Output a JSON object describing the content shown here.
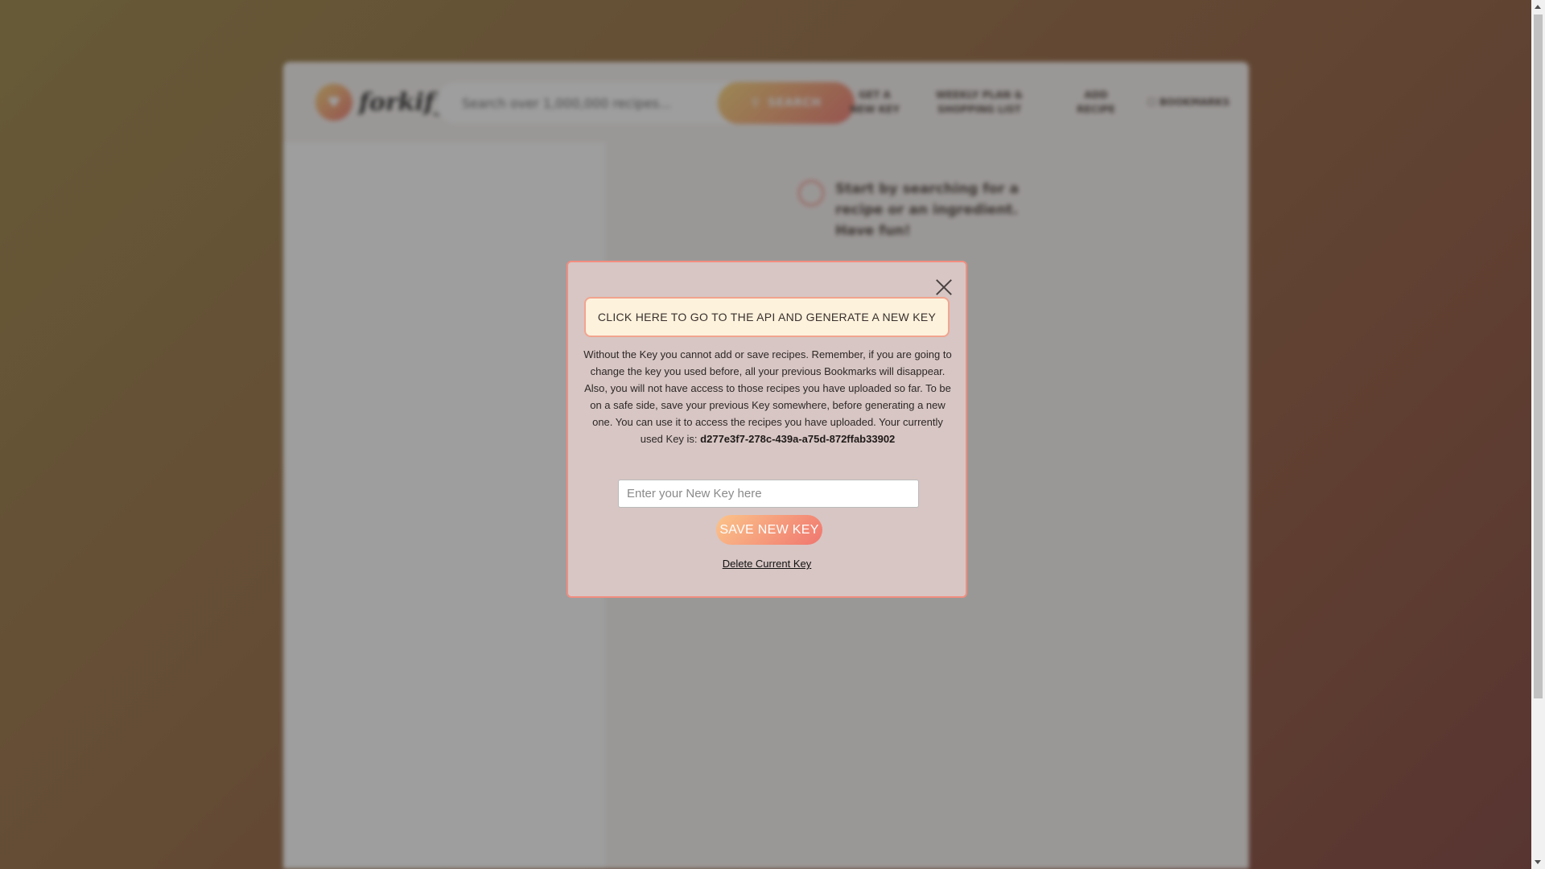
{
  "header": {
    "logo_text": "forkify",
    "search_placeholder": "Search over 1,000,000 recipes...",
    "search_button": "SEARCH",
    "nav": {
      "get_new_key": "GET A NEW KEY",
      "weekly_plan": "WEEKLY PLAN & SHOPPING LIST",
      "add_recipe": "ADD RECIPE",
      "bookmarks": "BOOKMARKS"
    }
  },
  "main": {
    "start_message": "Start by searching for a recipe or an ingredient. Have fun!"
  },
  "modal": {
    "api_link": "CLICK HERE TO GO TO THE API AND GENERATE A NEW KEY",
    "info_1": "Without the Key you cannot add or save recipes. Remember, if you are going to change the key you used before, all your previous Bookmarks will disappear.",
    "info_2": "Also, you will not have access to those recipes you have uploaded so far. To be on a safe side, save your previous Key somewhere, before generating a new one. You can use it to access the recipes you have uploaded. Your currently used Key is:",
    "current_key": "d277e3f7-278c-439a-a75d-872ffab33902",
    "key_placeholder": "Enter your New Key here",
    "save_button": "SAVE NEW KEY",
    "delete_link": "Delete Current Key"
  },
  "colors": {
    "accent_start": "#fbdb89",
    "accent_end": "#f48982",
    "modal_border": "#f28d80"
  }
}
